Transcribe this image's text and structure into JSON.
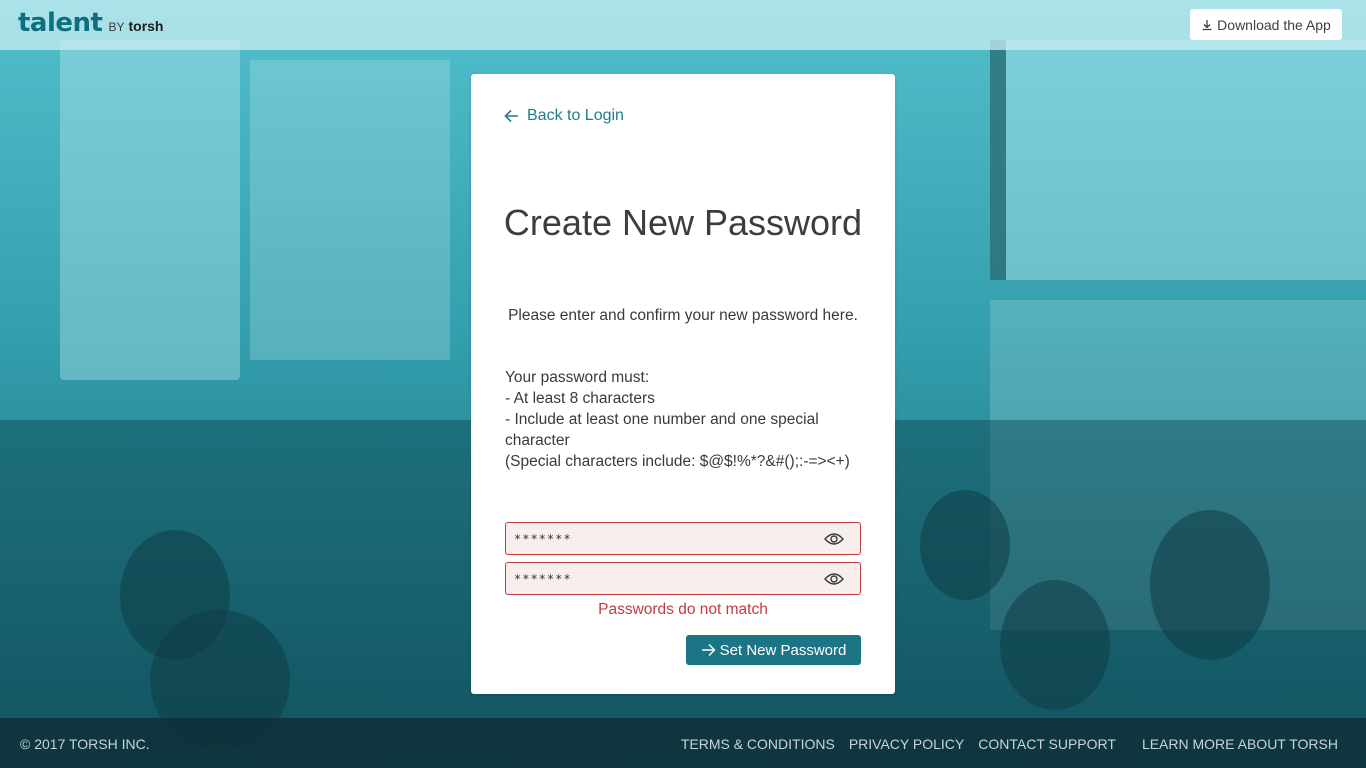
{
  "header": {
    "logo_main": "talent",
    "logo_by": "BY",
    "logo_torsh": "torsh",
    "download_label": "Download the App"
  },
  "card": {
    "back_label": "Back to Login",
    "title": "Create New Password",
    "subtitle": "Please enter and confirm your new password here.",
    "rules": {
      "heading": "Your password must:",
      "items": [
        "- At least 8 characters",
        "- Include at least one number and one special character",
        "(Special characters include: $@$!%*?&#();:-=><+)"
      ]
    },
    "password_value": "*******",
    "confirm_value": "*******",
    "error_text": "Passwords do not match",
    "submit_label": "Set New Password"
  },
  "footer": {
    "copyright": "© 2017 TORSH INC.",
    "links": [
      "TERMS & CONDITIONS",
      "PRIVACY POLICY",
      "CONTACT SUPPORT",
      "LEARN MORE ABOUT TORSH"
    ]
  },
  "colors": {
    "accent": "#1b7585",
    "link": "#1f7b8c",
    "error": "#c43b3b",
    "field_bg": "#f7efed"
  },
  "icons": {
    "back": "arrow-left-icon",
    "download": "download-icon",
    "visibility": "eye-icon",
    "submit": "arrow-right-icon"
  }
}
